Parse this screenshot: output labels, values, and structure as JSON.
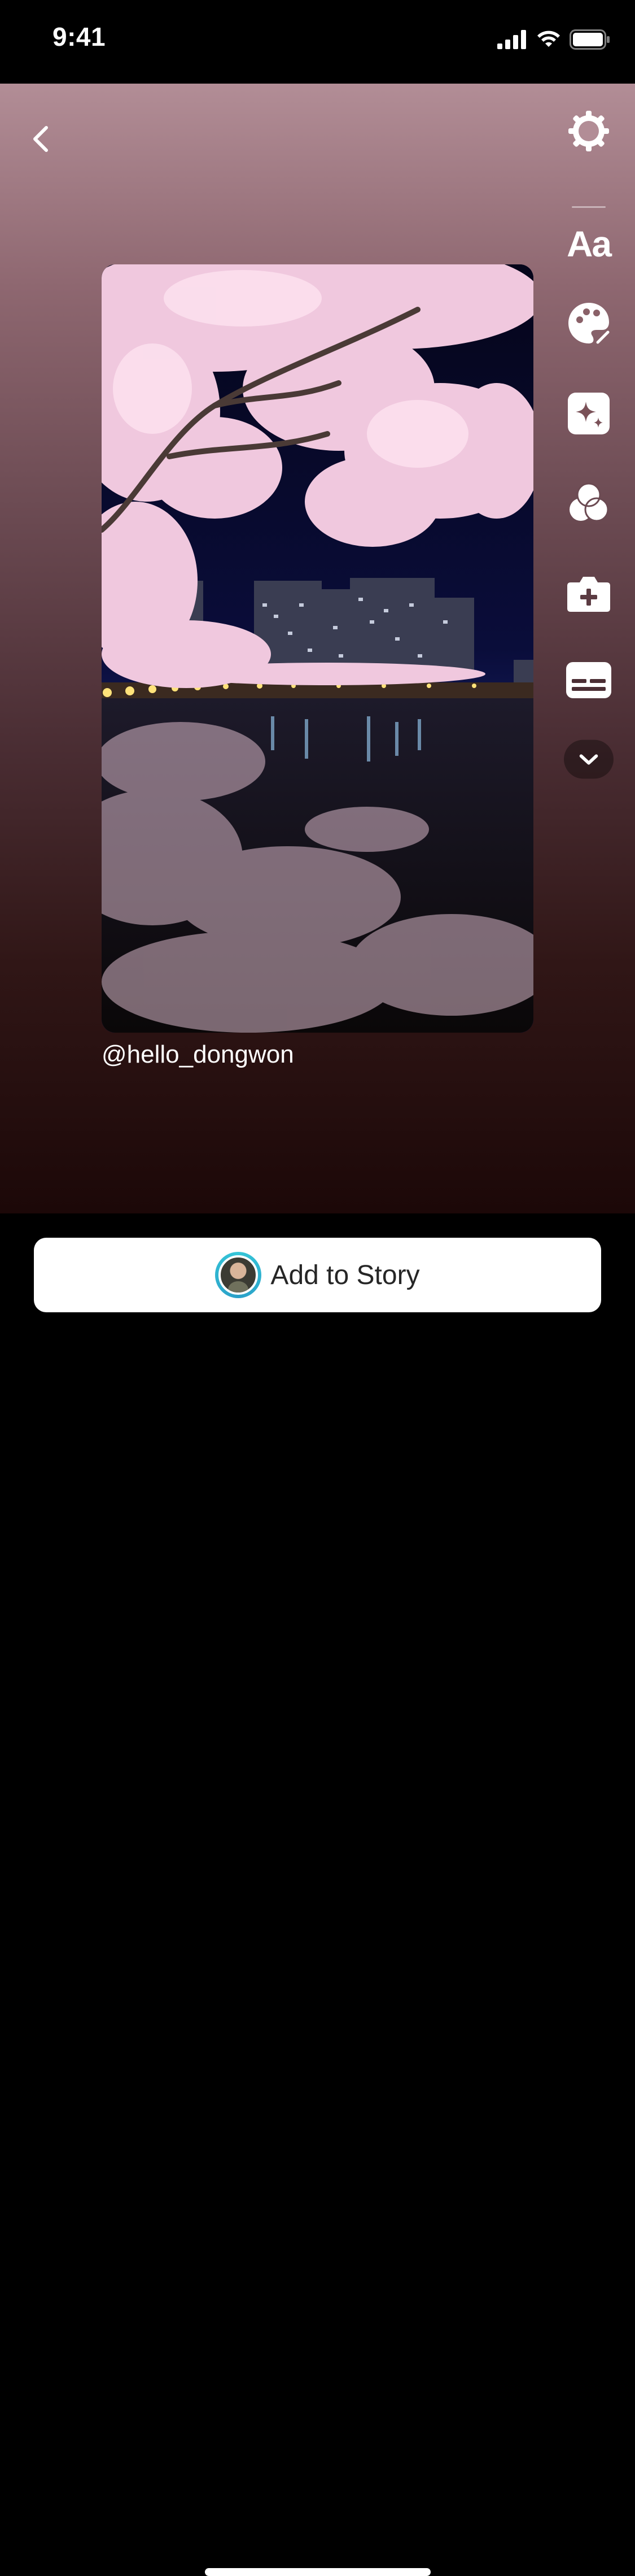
{
  "status_bar": {
    "time": "9:41"
  },
  "toolbar": {
    "text_tool_label": "Aa",
    "icons": [
      "settings-icon",
      "text-icon",
      "palette-icon",
      "sparkle-icon",
      "filters-icon",
      "add-camera-icon",
      "captions-icon",
      "chevron-down-icon"
    ]
  },
  "media": {
    "username": "@hello_dongwon"
  },
  "footer": {
    "add_to_story_label": "Add to Story"
  },
  "colors": {
    "button_bg": "#ffffff",
    "button_text": "#262626",
    "ring": "#35c6d8"
  }
}
